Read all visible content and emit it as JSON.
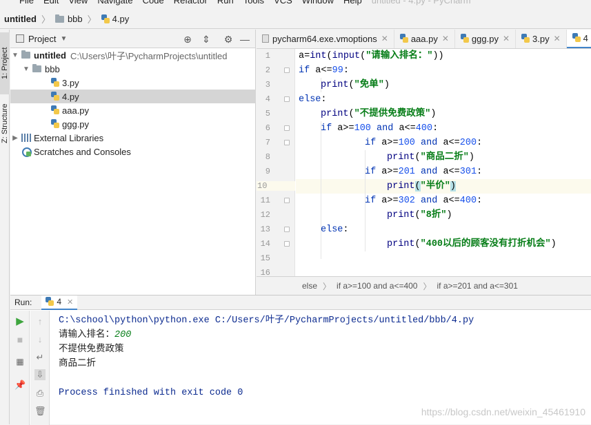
{
  "menubar": {
    "items": [
      "File",
      "Edit",
      "View",
      "Navigate",
      "Code",
      "Refactor",
      "Run",
      "Tools",
      "VCS",
      "Window",
      "Help"
    ],
    "title_dim": "untitled - 4.py - PyCharm"
  },
  "navbar": {
    "crumbs": [
      "untitled",
      "bbb",
      "4.py"
    ]
  },
  "leftstrip": {
    "project_tab": "1: Project",
    "structure_tab": "Z: Structure"
  },
  "project": {
    "title": "Project",
    "tree": {
      "root_name": "untitled",
      "root_path": "C:\\Users\\叶子\\PycharmProjects\\untitled",
      "folder": "bbb",
      "files": [
        "3.py",
        "4.py",
        "aaa.py",
        "ggg.py"
      ],
      "external": "External Libraries",
      "scratches": "Scratches and Consoles"
    }
  },
  "editor": {
    "tabs": [
      "pycharm64.exe.vmoptions",
      "aaa.py",
      "ggg.py",
      "3.py",
      "4"
    ],
    "line_numbers": [
      "1",
      "2",
      "3",
      "4",
      "5",
      "6",
      "7",
      "8",
      "9",
      "10",
      "11",
      "12",
      "13",
      "14",
      "15",
      "16"
    ],
    "breadcrumb": [
      "else",
      "if a>=100 and a<=400",
      "if a>=201 and a<=301"
    ]
  },
  "code": {
    "l1a": "a=",
    "l1b": "int",
    "l1c": "(",
    "l1d": "input",
    "l1e": "(",
    "l1f": "\"请输入排名：\"",
    "l1g": "))",
    "l2a": "if",
    "l2b": " a<=",
    "l2c": "99",
    "l2d": ":",
    "l3a": "print",
    "l3b": "(",
    "l3c": "\"免单\"",
    "l3d": ")",
    "l4a": "else",
    "l4b": ":",
    "l5a": "print",
    "l5b": "(",
    "l5c": "\"不提供免费政策\"",
    "l5d": ")",
    "l6a": "if",
    "l6b": " a>=",
    "l6c": "100",
    "l6d": " ",
    "l6e": "and",
    "l6f": " a<=",
    "l6g": "400",
    "l6h": ":",
    "l7a": "if",
    "l7b": " a>=",
    "l7c": "100",
    "l7d": " ",
    "l7e": "and",
    "l7f": " a<=",
    "l7g": "200",
    "l7h": ":",
    "l8a": "print",
    "l8b": "(",
    "l8c": "\"商品二折\"",
    "l8d": ")",
    "l9a": "if",
    "l9b": " a>=",
    "l9c": "201",
    "l9d": " ",
    "l9e": "and",
    "l9f": " a<=",
    "l9g": "301",
    "l9h": ":",
    "l10a": "print",
    "l10b": "(",
    "l10c": "\"半价\"",
    "l10d": ")",
    "l11a": "if",
    "l11b": " a>=",
    "l11c": "302",
    "l11d": " ",
    "l11e": "and",
    "l11f": " a<=",
    "l11g": "400",
    "l11h": ":",
    "l12a": "print",
    "l12b": "(",
    "l12c": "\"8折\"",
    "l12d": ")",
    "l13a": "else",
    "l13b": ":",
    "l14a": "print",
    "l14b": "(",
    "l14c": "\"400以后的顾客没有打折机会\"",
    "l14d": ")"
  },
  "run": {
    "label": "Run:",
    "tab_name": "4",
    "console": {
      "command": "C:\\school\\python\\python.exe C:/Users/叶子/PycharmProjects/untitled/bbb/4.py",
      "prompt": "请输入排名：",
      "input_value": "200",
      "out1": "不提供免费政策",
      "out2": "商品二折",
      "finish": "Process finished with exit code 0"
    }
  },
  "watermark": "https://blog.csdn.net/weixin_45461910",
  "colors": {
    "keyword": "#0033b3",
    "number": "#1750eb",
    "string": "#067d17",
    "selection": "#d5d5d5",
    "active_tab_underline": "#4083c9"
  }
}
